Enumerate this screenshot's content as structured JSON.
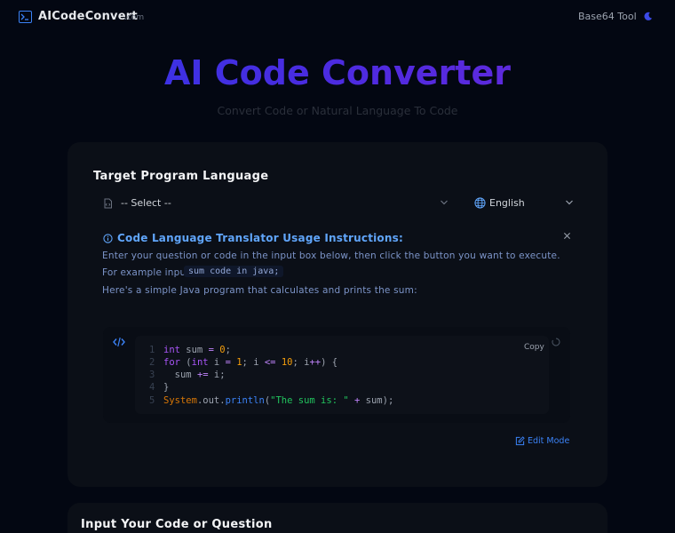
{
  "header": {
    "brand": "AICodeConvert",
    "brand_suffix": ".com",
    "nav_link": "Base64 Tool"
  },
  "hero": {
    "title": "AI Code Converter",
    "subtitle": "Convert Code or Natural Language To Code"
  },
  "target": {
    "title": "Target Program Language",
    "select_value": "-- Select --",
    "language_value": "English"
  },
  "instructions": {
    "title": "Code Language Translator Usage Instructions:",
    "line1": "Enter your question or code in the input box below, then click the button you want to execute.",
    "line2_prefix": "For example input:",
    "example_code": "sum code in java;",
    "line3": "Here's a simple Java program that calculates and prints the sum:"
  },
  "code_block": {
    "copy_label": "Copy",
    "edit_label": "Edit Mode",
    "lines": [
      {
        "n": "1",
        "tokens": [
          [
            "kw",
            "int"
          ],
          [
            "id",
            " sum "
          ],
          [
            "op",
            "="
          ],
          [
            "id",
            " "
          ],
          [
            "num",
            "0"
          ],
          [
            "pun",
            ";"
          ]
        ]
      },
      {
        "n": "2",
        "tokens": [
          [
            "kw",
            "for"
          ],
          [
            "pun",
            " ("
          ],
          [
            "kw",
            "int"
          ],
          [
            "id",
            " i "
          ],
          [
            "op",
            "="
          ],
          [
            "id",
            " "
          ],
          [
            "num",
            "1"
          ],
          [
            "pun",
            "; "
          ],
          [
            "id",
            "i "
          ],
          [
            "op",
            "<="
          ],
          [
            "id",
            " "
          ],
          [
            "num",
            "10"
          ],
          [
            "pun",
            "; "
          ],
          [
            "id",
            "i"
          ],
          [
            "op",
            "++"
          ],
          [
            "pun",
            ") {"
          ]
        ]
      },
      {
        "n": "3",
        "tokens": [
          [
            "id",
            "  sum "
          ],
          [
            "op",
            "+="
          ],
          [
            "id",
            " i"
          ],
          [
            "pun",
            ";"
          ]
        ]
      },
      {
        "n": "4",
        "tokens": [
          [
            "pun",
            "}"
          ]
        ]
      },
      {
        "n": "5",
        "tokens": [
          [
            "cls",
            "System"
          ],
          [
            "pun",
            "."
          ],
          [
            "id",
            "out"
          ],
          [
            "pun",
            "."
          ],
          [
            "fn",
            "println"
          ],
          [
            "pun",
            "("
          ],
          [
            "str",
            "\"The sum is: \""
          ],
          [
            "id",
            " "
          ],
          [
            "op",
            "+"
          ],
          [
            "id",
            " sum"
          ],
          [
            "pun",
            ");"
          ]
        ]
      }
    ]
  },
  "input_section": {
    "title": "Input Your Code or Question"
  },
  "colors": {
    "background": "#030712",
    "accent": "#3b82f6",
    "title_gradient_start": "#2f37e6",
    "title_gradient_end": "#6d28d9"
  },
  "icons": [
    "terminal-icon",
    "moon-icon",
    "file-code-icon",
    "chevron-down-icon",
    "globe-icon",
    "info-icon",
    "close-icon",
    "code-icon",
    "spinner-icon",
    "edit-icon"
  ]
}
